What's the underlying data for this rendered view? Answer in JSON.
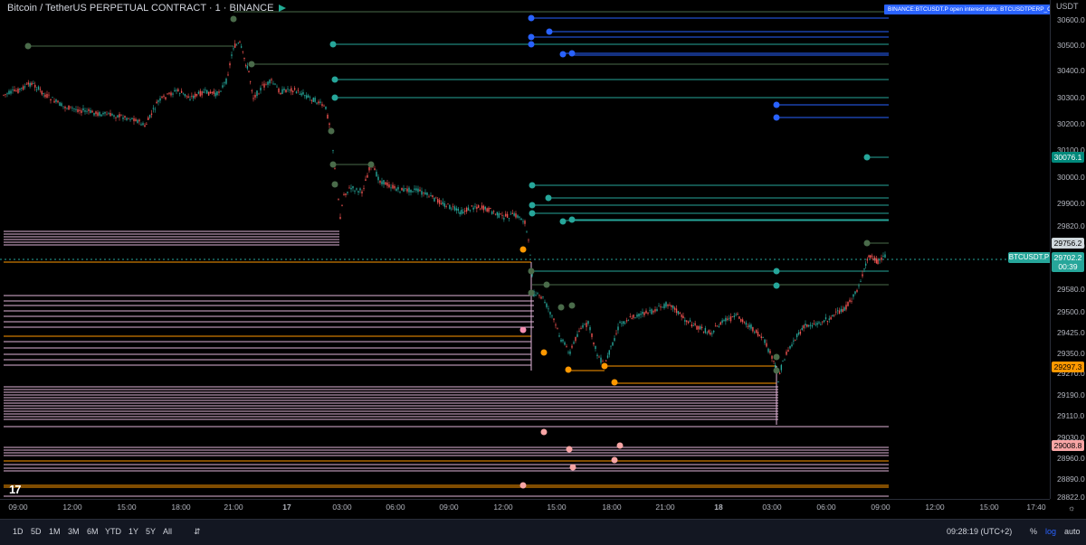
{
  "legend": {
    "title": "Bitcoin / TetherUS PERPETUAL CONTRACT · 1 · BINANCE",
    "flag_color": "#22ab94"
  },
  "indicator_badge": "BINANCE:BTCUSDT.P open interest data: BTCUSDTPERP_OI",
  "price_axis": {
    "currency": "USDT",
    "ticks": [
      "30600.0",
      "30500.0",
      "30400.0",
      "30300.0",
      "30200.0",
      "30100.0",
      "30000.0",
      "29900.0",
      "29820.0",
      "29740.0",
      "29580.0",
      "29500.0",
      "29425.0",
      "29350.0",
      "29270.0",
      "29190.0",
      "29110.0",
      "29030.0",
      "28960.0",
      "28890.0",
      "28822.0"
    ],
    "badges": [
      {
        "text": "30076.1",
        "bg": "#00897b",
        "fg": "#ffffff"
      },
      {
        "text": "29756.2",
        "bg": "#cfd8dc",
        "fg": "#000000"
      },
      {
        "text": "29702.2",
        "bg": "#26a69a",
        "fg": "#ffffff"
      },
      {
        "text": "00:39",
        "bg": "#26a69a",
        "fg": "#ffffff"
      },
      {
        "text": "29297.3",
        "bg": "#ff9800",
        "fg": "#000000"
      },
      {
        "text": "29008.8",
        "bg": "#f8a5a5",
        "fg": "#000000"
      }
    ],
    "symbol_badge": "BTCUSDT.P"
  },
  "time_axis": {
    "ticks": [
      "09:00",
      "12:00",
      "15:00",
      "18:00",
      "21:00",
      "17",
      "03:00",
      "06:00",
      "09:00",
      "12:00",
      "15:00",
      "18:00",
      "21:00",
      "18",
      "03:00",
      "06:00",
      "09:00",
      "12:00",
      "15:00",
      "17:40"
    ]
  },
  "bottom_bar": {
    "ranges": [
      "1D",
      "5D",
      "1M",
      "3M",
      "6M",
      "YTD",
      "1Y",
      "5Y",
      "All"
    ],
    "clock": "09:28:19 (UTC+2)",
    "percent": "%",
    "log": "log",
    "auto": "auto"
  },
  "logo": "17",
  "colors": {
    "up": "#26a69a",
    "down": "#ef5350",
    "teal_line": "#26a69a",
    "blue_line": "#2962ff",
    "orange_line": "#ff9800",
    "pink_line": "#f48fb1",
    "dark_green_line": "#4a6b4a"
  }
}
